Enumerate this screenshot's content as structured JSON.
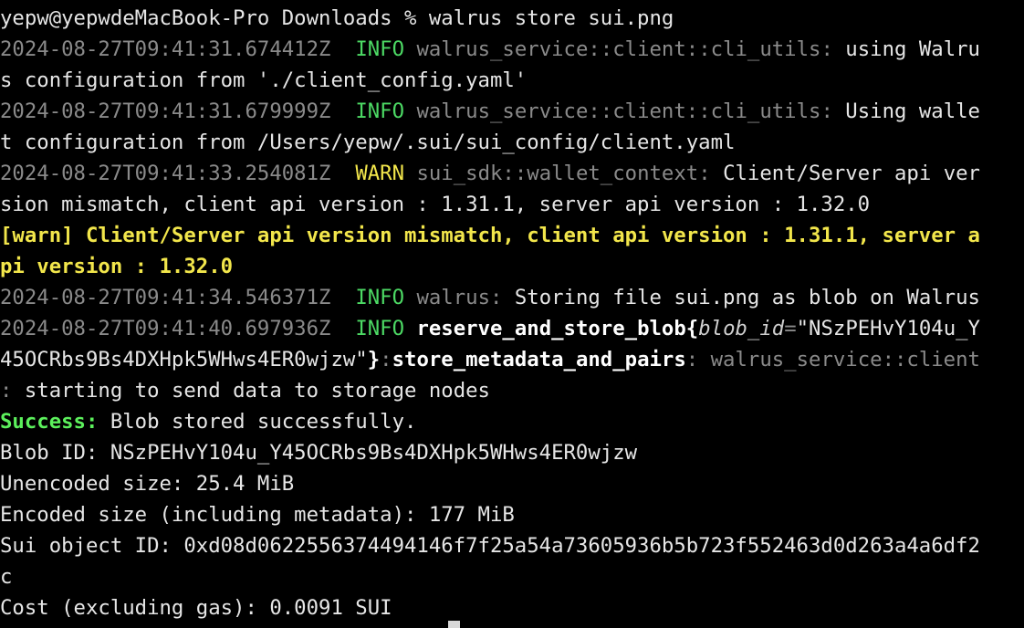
{
  "terminal": {
    "prompt": "yepw@yepwdeMacBook-Pro Downloads % ",
    "command": "walrus store sui.png",
    "log1": {
      "ts": "2024-08-27T09:41:31.674412Z",
      "level": "INFO",
      "target": "walrus_service::client::cli_utils:",
      "msg_a": " using Walru",
      "msg_b": "s configuration from './client_config.yaml'"
    },
    "log2": {
      "ts": "2024-08-27T09:41:31.679999Z",
      "level": "INFO",
      "target": "walrus_service::client::cli_utils:",
      "msg_a": " Using walle",
      "msg_b": "t configuration from /Users/yepw/.sui/sui_config/client.yaml"
    },
    "log3": {
      "ts": "2024-08-27T09:41:33.254081Z",
      "level": "WARN",
      "target": "sui_sdk::wallet_context:",
      "msg_a": " Client/Server api ver",
      "msg_b": "sion mismatch, client api version : 1.31.1, server api version : 1.32.0"
    },
    "warn_a": "[warn] Client/Server api version mismatch, client api version : 1.31.1, server a",
    "warn_b": "pi version : 1.32.0",
    "log4": {
      "ts": "2024-08-27T09:41:34.546371Z",
      "level": "INFO",
      "target": "walrus:",
      "msg": " Storing file sui.png as blob on Walrus"
    },
    "log5": {
      "ts": "2024-08-27T09:41:40.697936Z",
      "level": "INFO",
      "span1": "reserve_and_store_blob",
      "brace_open": "{",
      "field": "blob_id",
      "eq": "=",
      "val_a": "\"NSzPEHvY104u_Y",
      "val_b": "45OCRbs9Bs4DXHpk5WHws4ER0wjzw\"",
      "brace_close": "}",
      "colon": ":",
      "span2": "store_metadata_and_pairs",
      "target_a": ": walrus_service::client",
      "target_b": ":",
      "msg": " starting to send data to storage nodes"
    },
    "success_label": "Success:",
    "success_msg": " Blob stored successfully.",
    "blob_id": "Blob ID: NSzPEHvY104u_Y45OCRbs9Bs4DXHpk5WHws4ER0wjzw",
    "unencoded": "Unencoded size: 25.4 MiB",
    "encoded": "Encoded size (including metadata): 177 MiB",
    "object_id_a": "Sui object ID: 0xd08d0622556374494146f7f25a54a73605936b5b723f552463d0d263a4a6df2",
    "object_id_b": "c",
    "cost": "Cost (excluding gas): 0.0091 SUI"
  },
  "colors": {
    "background": "#000000",
    "text": "#e6e6e6",
    "dim": "#8a8a8a",
    "info": "#4cd964",
    "warn": "#f2e64b",
    "success": "#5cf05c"
  }
}
